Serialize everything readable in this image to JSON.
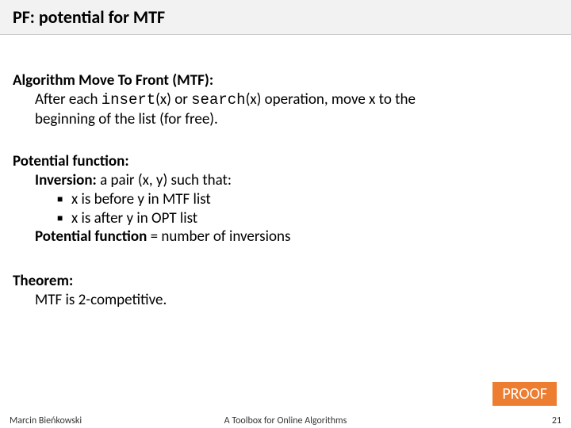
{
  "title": "PF: potential for MTF",
  "algo": {
    "header": "Algorithm Move To Front (MTF):",
    "line1_a": "After each ",
    "line1_insert": "insert",
    "line1_b": "(x) or ",
    "line1_search": "search",
    "line1_c": "(x) operation, move x to the",
    "line2": "beginning of the list (for free)."
  },
  "potential": {
    "header": "Potential function:",
    "inv_head": "Inversion: ",
    "inv_tail": "a pair (x, y) such that:",
    "b1": "x is before y in MTF list",
    "b2": "x is after y in OPT list",
    "pf_head": "Potential function ",
    "pf_tail": "= number of inversions"
  },
  "theorem": {
    "header": "Theorem:",
    "line": "MTF is 2-competitive."
  },
  "proof_badge": "PROOF",
  "footer": {
    "left": "Marcin Bieńkowski",
    "center": "A Toolbox for Online Algorithms",
    "right": "21"
  }
}
